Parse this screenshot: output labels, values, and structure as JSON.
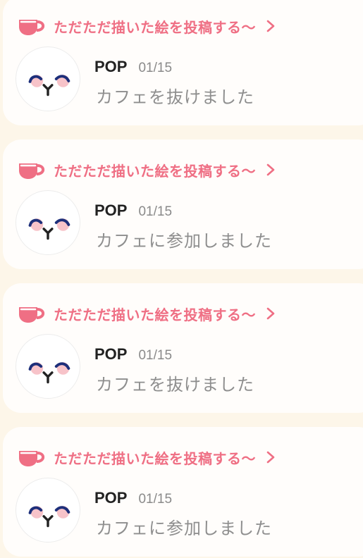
{
  "feed": {
    "items": [
      {
        "cafe_name": "ただただ描いた絵を投稿する〜",
        "user": "POP",
        "date": "01/15",
        "activity": "カフェを抜けました"
      },
      {
        "cafe_name": "ただただ描いた絵を投稿する〜",
        "user": "POP",
        "date": "01/15",
        "activity": "カフェに参加しました"
      },
      {
        "cafe_name": "ただただ描いた絵を投稿する〜",
        "user": "POP",
        "date": "01/15",
        "activity": "カフェを抜けました"
      },
      {
        "cafe_name": "ただただ描いた絵を投稿する〜",
        "user": "POP",
        "date": "01/15",
        "activity": "カフェに参加しました"
      }
    ]
  },
  "icons": {
    "cafe": "coffee-cup-icon",
    "more": "chevron-right-icon"
  },
  "colors": {
    "accent": "#ef6f84",
    "background": "#fdf6e9",
    "card": "#fffdfb",
    "username": "#222222",
    "meta": "#8a8a8a"
  }
}
